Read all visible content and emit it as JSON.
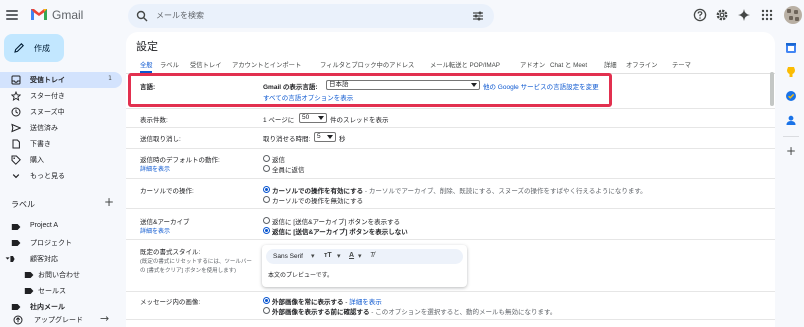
{
  "app": {
    "name": "Gmail"
  },
  "search": {
    "placeholder": "メールを検索"
  },
  "topbar_icons": [
    "help-icon",
    "settings-icon",
    "gemini-sparkle-icon",
    "apps-grid-icon",
    "avatar"
  ],
  "compose": {
    "label": "作成"
  },
  "nav": {
    "items": [
      {
        "label": "受信トレイ",
        "count": "1",
        "icon": "inbox-icon"
      },
      {
        "label": "スター付き",
        "icon": "star-icon"
      },
      {
        "label": "スヌーズ中",
        "icon": "clock-icon"
      },
      {
        "label": "送信済み",
        "icon": "send-icon"
      },
      {
        "label": "下書き",
        "icon": "draft-icon"
      },
      {
        "label": "購入",
        "icon": "tag-icon"
      },
      {
        "label": "もっと見る",
        "icon": "chevron-down-icon"
      }
    ],
    "labels_heading": "ラベル",
    "labels_add": "+",
    "labels": [
      {
        "label": "Project A",
        "icon": "label-icon"
      },
      {
        "label": "プロジェクト",
        "icon": "label-icon"
      },
      {
        "label": "顧客対応",
        "icon": "label-icon"
      },
      {
        "label": "お問い合わせ",
        "icon": "label-icon"
      },
      {
        "label": "セールス",
        "icon": "label-icon"
      },
      {
        "label": "社内メール",
        "icon": "label-icon"
      }
    ],
    "upgrade_label": "アップグレード"
  },
  "settings": {
    "title": "設定",
    "tabs": [
      "全般",
      "ラベル",
      "受信トレイ",
      "アカウントとインポート",
      "フィルタとブロック中のアドレス",
      "メール転送と POP/IMAP",
      "アドオン",
      "Chat と Meet",
      "詳細",
      "オフライン",
      "テーマ"
    ],
    "active_tab": "全般",
    "language": {
      "label": "言語:",
      "display_label": "Gmail の表示言語:",
      "selected": "日本語",
      "change_link": "他の Google サービスの言語設定を変更",
      "all_options_link": "すべての言語オプションを表示"
    },
    "page_size": {
      "label": "表示件数:",
      "prefix": "1 ページに",
      "value": "50",
      "suffix": "件のスレッドを表示"
    },
    "undo_send": {
      "label": "送信取り消し:",
      "prefix": "取り消せる時間:",
      "value": "5",
      "suffix": "秒"
    },
    "default_reply": {
      "label": "返信時のデフォルトの動作:",
      "link": "詳細を表示",
      "options": [
        "返信",
        "全員に返信"
      ],
      "selected_index": -1
    },
    "hover_actions": {
      "label": "カーソルでの操作:",
      "opt1_bold": "カーソルでの操作を有効にする",
      "opt1_rest": " - カーソルでアーカイブ、削除、既読にする、スヌーズの操作をすばやく行えるようになります。",
      "opt2": "カーソルでの操作を無効にする",
      "selected_index": 0
    },
    "send_archive": {
      "label": "送信&アーカイブ",
      "link": "詳細を表示",
      "opt1": "返信に [送信&アーカイブ] ボタンを表示する",
      "opt2": "返信に [送信&アーカイブ] ボタンを表示しない",
      "selected_index": 1
    },
    "default_text_style": {
      "label": "既定の書式スタイル:",
      "note1": "(既定の書式にリセットするには、ツールバー",
      "note2": "の [書式をクリア] ボタンを使用します)",
      "font": "Sans Serif",
      "preview": "本文のプレビューです。"
    },
    "images": {
      "label": "メッセージ内の画像:",
      "opt1_bold": "外部画像を常に表示する",
      "opt1_sep": " - ",
      "opt1_link": "詳細を表示",
      "opt2_bold": "外部画像を表示する前に確認する",
      "opt2_rest": " - このオプションを選択すると、動的メールも無効になります。",
      "selected_index": 0
    }
  }
}
